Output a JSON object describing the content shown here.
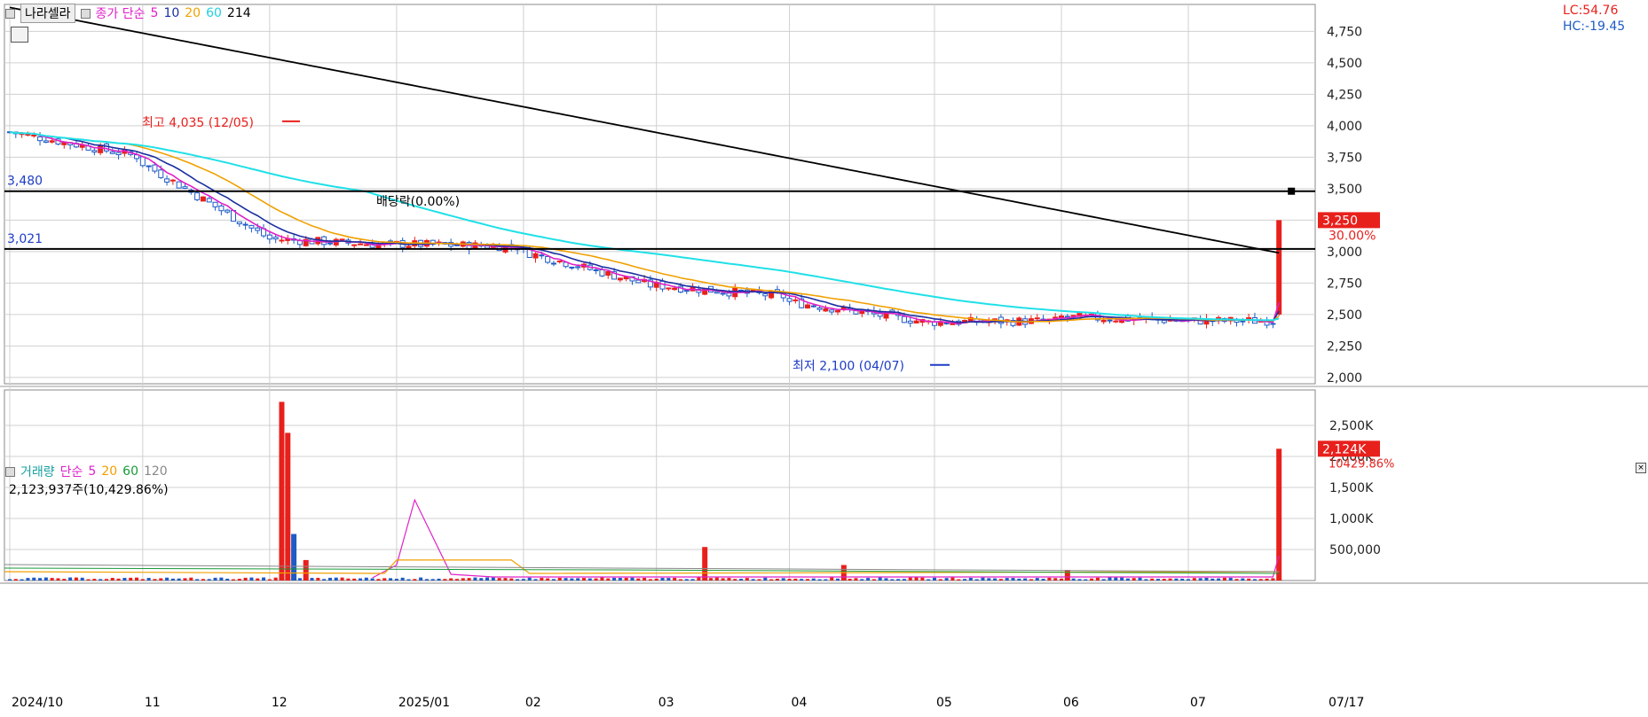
{
  "header": {
    "stock_name": "나라셀라",
    "price_legend": {
      "label": "종가 단순",
      "periods": [
        "5",
        "10",
        "20",
        "60",
        "214"
      ]
    },
    "lc_label": "LC:54.76",
    "hc_label": "HC:-19.45"
  },
  "volume_header": {
    "label": "거래량",
    "ma_label": "단순",
    "periods": [
      "5",
      "20",
      "60",
      "120"
    ],
    "volume_text": "2,123,937주(10,429.86%)"
  },
  "annotations": {
    "high": "최고 4,035 (12/05)",
    "low": "최저 2,100 (04/07)",
    "dividend": "배당락(0.00%)",
    "hline1_label": "3,480",
    "hline2_label": "3,021",
    "last_price": "3,250",
    "last_change": "30.00%",
    "last_volume": "2,124K",
    "last_volume_pct": "10429.86%"
  },
  "colors": {
    "up": "#e8201c",
    "down": "#1e5bc6",
    "ma5": "#e020c8",
    "ma10": "#1a2fa0",
    "ma20": "#f0a000",
    "ma60": "#20e0e8",
    "ma214": "#000000",
    "vma5": "#e020c8",
    "vma20": "#f0a000",
    "vma60": "#1a9a3a",
    "vma120": "#888888",
    "grid": "#d0d0d0"
  },
  "chart_data": [
    {
      "type": "candlestick",
      "title": "",
      "ylim": [
        1950,
        4950
      ],
      "y_ticks": [
        "2,000",
        "2,250",
        "2,500",
        "2,750",
        "3,000",
        "3,250",
        "3,500",
        "3,750",
        "4,000",
        "4,250",
        "4,500",
        "4,750"
      ],
      "x_month_labels": [
        "2024/10",
        "11",
        "12",
        "2025/01",
        "02",
        "03",
        "04",
        "05",
        "06",
        "07"
      ],
      "x_right_label": "07/17",
      "horizontal_lines": [
        3480,
        3021
      ],
      "months": [
        {
          "label": "2024/10",
          "days": 22,
          "close_start": 3950,
          "close_end": 3750
        },
        {
          "label": "11",
          "days": 21,
          "close_start": 3700,
          "close_end": 3100
        },
        {
          "label": "12",
          "days": 21,
          "close_start": 3100,
          "close_end": 3050
        },
        {
          "label": "2025/01",
          "days": 21,
          "close_start": 3060,
          "close_end": 3040
        },
        {
          "label": "02",
          "days": 22,
          "close_start": 3000,
          "close_end": 2720
        },
        {
          "label": "03",
          "days": 22,
          "close_start": 2730,
          "close_end": 2640
        },
        {
          "label": "04",
          "days": 24,
          "close_start": 2600,
          "close_end": 2430
        },
        {
          "label": "05",
          "days": 21,
          "close_start": 2440,
          "close_end": 2450
        },
        {
          "label": "06",
          "days": 21,
          "close_start": 2480,
          "close_end": 2450
        },
        {
          "label": "07",
          "days": 15,
          "close_start": 2450,
          "close_end": 2450
        }
      ],
      "last_day": {
        "open": 2500,
        "high": 3250,
        "low": 2490,
        "close": 3250
      },
      "ma214": {
        "start": 4940,
        "end": 2990
      },
      "high_marker": {
        "value": 4035,
        "date": "12/05"
      },
      "low_marker": {
        "value": 2100,
        "date": "04/07"
      }
    },
    {
      "type": "bar",
      "title": "",
      "ylim": [
        0,
        2900000
      ],
      "y_ticks": [
        "500,000",
        "1,000K",
        "1,500K",
        "2,000K",
        "2,500K"
      ],
      "spikes": [
        {
          "date": "12/04",
          "value": 2880000,
          "dir": "up"
        },
        {
          "date": "12/05",
          "value": 2380000,
          "dir": "up"
        },
        {
          "date": "12/06",
          "value": 750000,
          "dir": "down"
        },
        {
          "date": "12/09",
          "value": 330000,
          "dir": "up"
        },
        {
          "date": "03/13",
          "value": 540000,
          "dir": "up"
        },
        {
          "date": "04/14",
          "value": 250000,
          "dir": "up"
        },
        {
          "date": "06/02",
          "value": 170000,
          "dir": "up"
        },
        {
          "date": "07/17",
          "value": 2123937,
          "dir": "up"
        }
      ]
    }
  ]
}
